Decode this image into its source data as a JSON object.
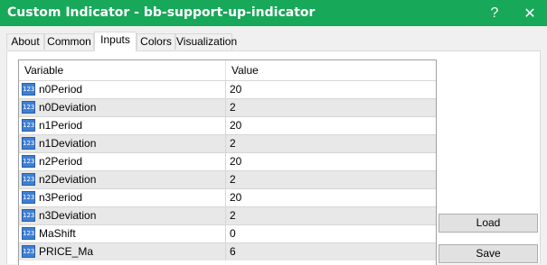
{
  "window": {
    "title": "Custom Indicator - bb-support-up-indicator",
    "help_glyph": "?",
    "close_glyph": "✕"
  },
  "tabs": [
    "About",
    "Common",
    "Inputs",
    "Colors",
    "Visualization"
  ],
  "active_tab": "Inputs",
  "table": {
    "headers": {
      "variable": "Variable",
      "value": "Value"
    },
    "icon_text": "123",
    "rows": [
      {
        "variable": "n0Period",
        "value": "20"
      },
      {
        "variable": "n0Deviation",
        "value": "2"
      },
      {
        "variable": "n1Period",
        "value": "20"
      },
      {
        "variable": "n1Deviation",
        "value": "2"
      },
      {
        "variable": "n2Period",
        "value": "20"
      },
      {
        "variable": "n2Deviation",
        "value": "2"
      },
      {
        "variable": "n3Period",
        "value": "20"
      },
      {
        "variable": "n3Deviation",
        "value": "2"
      },
      {
        "variable": "MaShift",
        "value": "0"
      },
      {
        "variable": "PRICE_Ma",
        "value": "6"
      }
    ]
  },
  "buttons": {
    "load": "Load",
    "save": "Save"
  },
  "colors": {
    "titlebar": "#17a85a"
  }
}
